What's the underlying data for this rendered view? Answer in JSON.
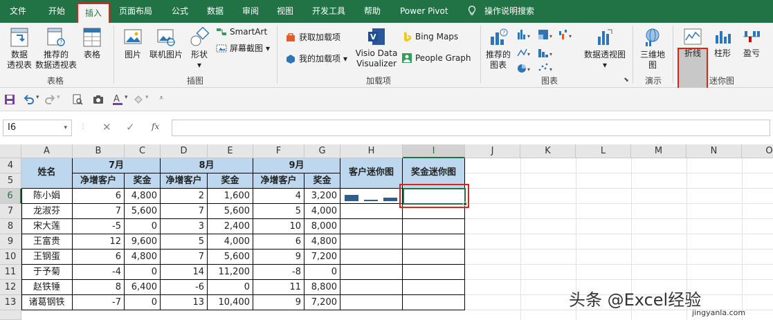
{
  "menu": {
    "tabs": [
      "文件",
      "开始",
      "插入",
      "页面布局",
      "公式",
      "数据",
      "审阅",
      "视图",
      "开发工具",
      "帮助",
      "Power Pivot"
    ],
    "active": "插入",
    "search": "操作说明搜索"
  },
  "ribbon": {
    "tables": {
      "pivot_l1": "数据",
      "pivot_l2": "透视表",
      "rec_l1": "推荐的",
      "rec_l2": "数据透视表",
      "table": "表格",
      "label": "表格"
    },
    "illustrations": {
      "picture": "图片",
      "online": "联机图片",
      "shapes_l1": "形状",
      "smartart": "SmartArt",
      "screenshot": "屏幕截图",
      "label": "插图"
    },
    "addins": {
      "get": "获取加载项",
      "my": "我的加载项",
      "visio_l1": "Visio Data",
      "visio_l2": "Visualizer",
      "bing": "Bing Maps",
      "people": "People Graph",
      "label": "加载项"
    },
    "charts": {
      "rec_l1": "推荐的",
      "rec_l2": "图表",
      "pivotchart": "数据透视图",
      "label": "图表"
    },
    "tours": {
      "map_l1": "三维地",
      "map_l2": "图",
      "label": "演示"
    },
    "sparklines": {
      "line": "折线",
      "column": "柱形",
      "winloss": "盈亏",
      "label": "迷你图"
    }
  },
  "formula_bar": {
    "name_box": "I6",
    "fx": "fx",
    "value": ""
  },
  "columns": [
    "A",
    "B",
    "C",
    "D",
    "E",
    "F",
    "G",
    "H",
    "I",
    "J",
    "K",
    "L",
    "M",
    "N",
    "O"
  ],
  "rows": [
    "4",
    "5",
    "6",
    "7",
    "8",
    "9",
    "10",
    "11",
    "12",
    "13"
  ],
  "table": {
    "name_header": "姓名",
    "months": [
      "7月",
      "8月",
      "9月"
    ],
    "sub_headers": [
      "净增客户",
      "奖金"
    ],
    "cust_spark": "客户迷你图",
    "bonus_spark": "奖金迷你图",
    "data": [
      [
        "陈小娟",
        "6",
        "4,800",
        "2",
        "1,600",
        "4",
        "3,200"
      ],
      [
        "龙淑芬",
        "7",
        "5,600",
        "7",
        "5,600",
        "5",
        "4,000"
      ],
      [
        "宋大莲",
        "-5",
        "0",
        "3",
        "2,400",
        "10",
        "8,000"
      ],
      [
        "王富贵",
        "12",
        "9,600",
        "5",
        "4,000",
        "6",
        "4,800"
      ],
      [
        "王钢蛋",
        "6",
        "4,800",
        "7",
        "5,600",
        "9",
        "7,200"
      ],
      [
        "于予菊",
        "-4",
        "0",
        "14",
        "11,200",
        "-8",
        "0"
      ],
      [
        "赵铁锤",
        "8",
        "6,400",
        "-6",
        "0",
        "11",
        "8,800"
      ],
      [
        "诸葛钢铁",
        "-7",
        "0",
        "13",
        "10,400",
        "9",
        "7,200"
      ]
    ]
  },
  "watermark": {
    "main": "头条 @Excel经验",
    "sub": "jingyanla.com"
  }
}
